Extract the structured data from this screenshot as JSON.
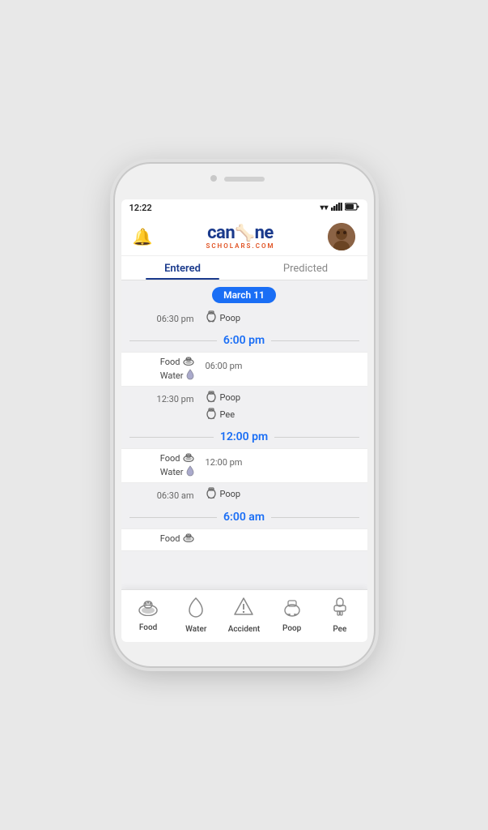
{
  "status_bar": {
    "time": "12:22",
    "icons": [
      "wifi",
      "signal",
      "battery"
    ]
  },
  "header": {
    "bell_label": "🔔",
    "logo_main": "can",
    "logo_bone": "🦴",
    "logo_end": "ne",
    "logo_subtitle": "SCHOLARS.COM",
    "avatar_initials": "🐕"
  },
  "tabs": [
    {
      "label": "Entered",
      "active": true
    },
    {
      "label": "Predicted",
      "active": false
    }
  ],
  "date_badge": "March 11",
  "timeline": [
    {
      "type": "event_right",
      "left_time": "06:30 pm",
      "events": [
        {
          "icon": "toilet",
          "label": "Poop"
        }
      ]
    },
    {
      "type": "hour_divider",
      "hour": "6:00 pm"
    },
    {
      "type": "event_left_right",
      "left_labels": [
        "Food",
        "Water"
      ],
      "right_time": "06:00 pm",
      "events": []
    },
    {
      "type": "event_right",
      "left_time": "12:30 pm",
      "events": [
        {
          "icon": "toilet",
          "label": "Poop"
        },
        {
          "icon": "toilet",
          "label": "Pee"
        }
      ]
    },
    {
      "type": "hour_divider",
      "hour": "12:00 pm"
    },
    {
      "type": "event_left_right",
      "left_labels": [
        "Food",
        "Water"
      ],
      "right_time": "12:00 pm",
      "events": []
    },
    {
      "type": "event_right",
      "left_time": "06:30 am",
      "events": [
        {
          "icon": "toilet",
          "label": "Poop"
        }
      ]
    },
    {
      "type": "hour_divider",
      "hour": "6:00 am"
    },
    {
      "type": "event_left_only",
      "left_labels": [
        "Food"
      ]
    }
  ],
  "bottom_nav": [
    {
      "icon": "bowl",
      "label": "Food"
    },
    {
      "icon": "drop",
      "label": "Water"
    },
    {
      "icon": "warning",
      "label": "Accident"
    },
    {
      "icon": "toilet",
      "label": "Poop"
    },
    {
      "icon": "hydrant",
      "label": "Pee"
    }
  ]
}
